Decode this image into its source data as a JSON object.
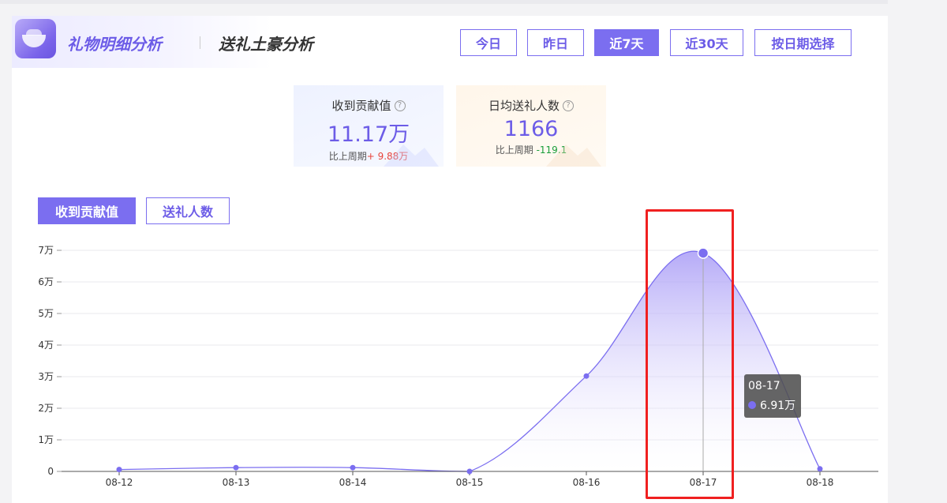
{
  "header": {
    "title_main": "礼物明细分析",
    "title_sub": "送礼土豪分析"
  },
  "range_buttons": [
    {
      "label": "今日",
      "active": false
    },
    {
      "label": "昨日",
      "active": false
    },
    {
      "label": "近7天",
      "active": true
    },
    {
      "label": "近30天",
      "active": false
    },
    {
      "label": "按日期选择",
      "active": false
    }
  ],
  "stats": [
    {
      "label": "收到贡献值",
      "value": "11.17万",
      "compare_label": "比上周期",
      "compare_value": "+ 9.88万"
    },
    {
      "label": "日均送礼人数",
      "value": "1166",
      "compare_label": "比上周期",
      "compare_value": "-119.1"
    }
  ],
  "chart_tabs": [
    {
      "label": "收到贡献值",
      "active": true
    },
    {
      "label": "送礼人数",
      "active": false
    }
  ],
  "tooltip": {
    "date": "08-17",
    "value": "6.91万"
  },
  "colors": {
    "accent": "#7b6ef0",
    "up": "#e8453c",
    "down": "#1a9e3a",
    "highlight": "#f02020"
  },
  "chart_data": {
    "type": "area",
    "categories": [
      "08-12",
      "08-13",
      "08-14",
      "08-15",
      "08-16",
      "08-17",
      "08-18"
    ],
    "values": [
      600,
      1200,
      1200,
      0,
      30200,
      69100,
      800
    ],
    "ylim": [
      0,
      70000
    ],
    "yticks": [
      {
        "v": 0,
        "label": "0"
      },
      {
        "v": 10000,
        "label": "1万"
      },
      {
        "v": 20000,
        "label": "2万"
      },
      {
        "v": 30000,
        "label": "3万"
      },
      {
        "v": 40000,
        "label": "4万"
      },
      {
        "v": 50000,
        "label": "5万"
      },
      {
        "v": 60000,
        "label": "6万"
      },
      {
        "v": 70000,
        "label": "7万"
      }
    ],
    "highlighted_category": "08-17",
    "grid": true
  }
}
